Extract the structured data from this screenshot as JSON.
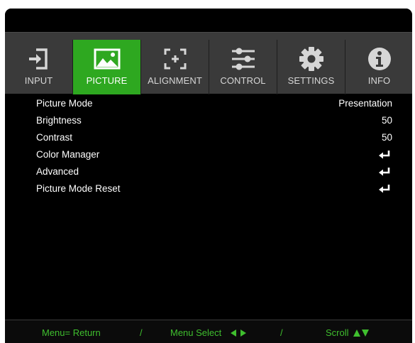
{
  "tabs": [
    {
      "label": "INPUT",
      "icon": "input-icon",
      "active": false
    },
    {
      "label": "PICTURE",
      "icon": "picture-icon",
      "active": true
    },
    {
      "label": "ALIGNMENT",
      "icon": "alignment-icon",
      "active": false
    },
    {
      "label": "CONTROL",
      "icon": "control-sliders-icon",
      "active": false
    },
    {
      "label": "SETTINGS",
      "icon": "gear-icon",
      "active": false
    },
    {
      "label": "INFO",
      "icon": "info-icon",
      "active": false
    }
  ],
  "menu": {
    "items": [
      {
        "label": "Picture Mode",
        "value": "Presentation"
      },
      {
        "label": "Brightness",
        "value": "50"
      },
      {
        "label": "Contrast",
        "value": "50"
      },
      {
        "label": "Color Manager",
        "value_icon": "enter-icon"
      },
      {
        "label": "Advanced",
        "value_icon": "enter-icon"
      },
      {
        "label": "Picture Mode Reset",
        "value_icon": "enter-icon"
      }
    ]
  },
  "footer": {
    "menu_return": "Menu= Return",
    "separator": "/",
    "menu_select": "Menu Select",
    "scroll": "Scroll"
  },
  "colors": {
    "accent_green": "#2ea820",
    "footer_text_green": "#3fbf2e",
    "tabbar_gray": "#3a3a3a",
    "background": "#000000"
  }
}
